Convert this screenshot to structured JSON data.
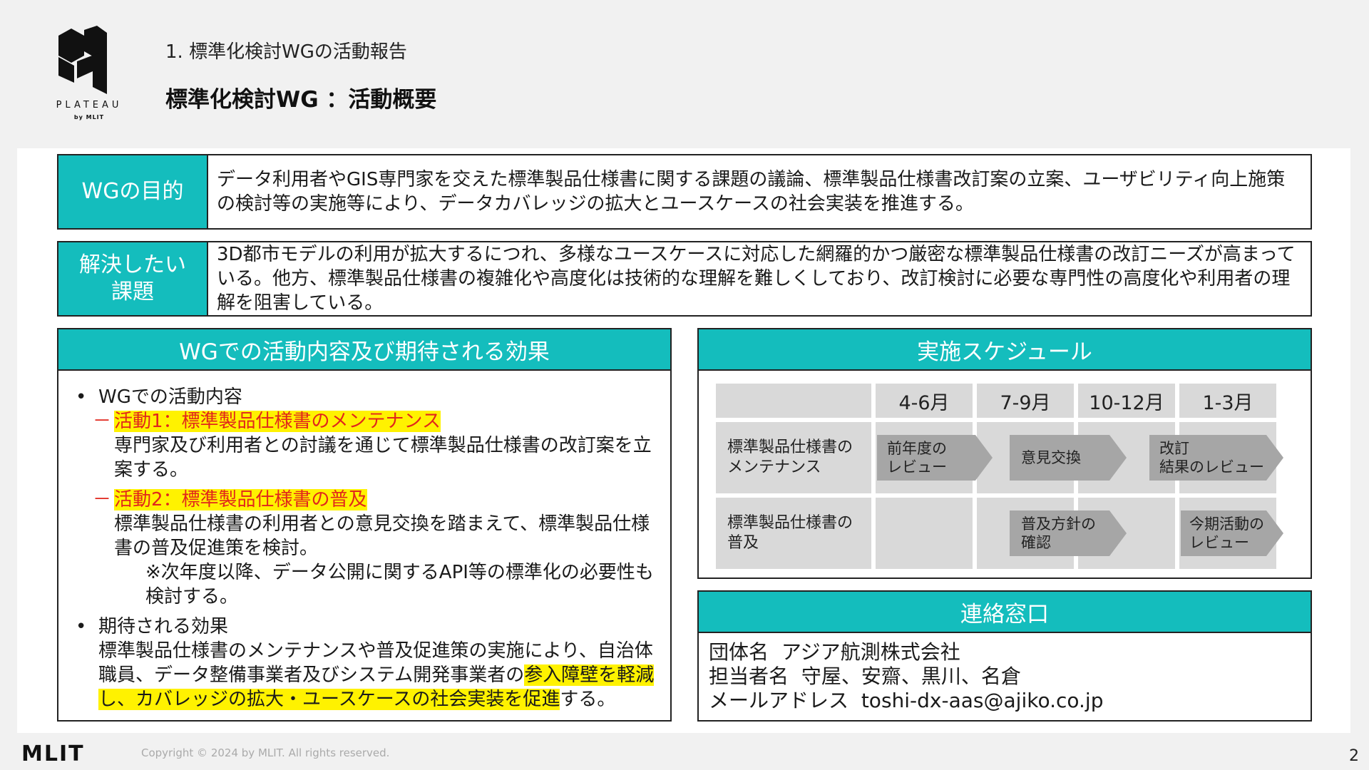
{
  "header": {
    "logo_text": "PLATEAU",
    "logo_sub": "by MLIT",
    "section_title": "1. 標準化検討WGの活動報告",
    "page_title": "標準化検討WG ：活動概要"
  },
  "purpose": {
    "label": "WGの目的",
    "text": "データ利用者やGIS専門家を交えた標準製品仕様書に関する課題の議論、標準製品仕様書改訂案の立案、ユーザビリティ向上施策の検討等の実施等により、データカバレッジの拡大とユースケースの社会実装を推進する。"
  },
  "issue": {
    "label_line1": "解決したい",
    "label_line2": "課題",
    "text": "3D都市モデルの利用が拡大するにつれ、多様なユースケースに対応した網羅的かつ厳密な標準製品仕様書の改訂ニーズが高まっている。他方、標準製品仕様書の複雑化や高度化は技術的な理解を難しくしており、改訂検討に必要な専門性の高度化や利用者の理解を阻害している。"
  },
  "activities": {
    "title": "WGでの活動内容及び期待される効果",
    "bullet1": "WGでの活動内容",
    "item1_title": "活動1：標準製品仕様書のメンテナンス",
    "item1_body": "専門家及び利用者との討議を通じて標準製品仕様書の改訂案を立案する。",
    "item2_title": "活動2：標準製品仕様書の普及",
    "item2_body": "標準製品仕様書の利用者との意見交換を踏まえて、標準製品仕様書の普及促進策を検討。",
    "item2_note": "※次年度以降、データ公開に関するAPI等の標準化の必要性も検討する。",
    "bullet2": "期待される効果",
    "effect_pre": "標準製品仕様書のメンテナンスや普及促進策の実施により、自治体職員、データ整備事業者及びシステム開発事業者の",
    "effect_highlight": "参入障壁を軽減し、カバレッジの拡大・ユースケースの社会実装を促進",
    "effect_post": "する。"
  },
  "schedule": {
    "title": "実施スケジュール",
    "periods": [
      "4-6月",
      "7-9月",
      "10-12月",
      "1-3月"
    ],
    "rows": [
      {
        "label": "標準製品仕様書の\nメンテナンス",
        "tasks": [
          "前年度の\nレビュー",
          "意見交換",
          "改訂\n結果のレビュー"
        ]
      },
      {
        "label": "標準製品仕様書の\n普及",
        "tasks": [
          "普及方針の\n確認",
          "今期活動の\nレビュー"
        ]
      }
    ]
  },
  "contact": {
    "title": "連絡窓口",
    "org_label": "団体名",
    "org_value": "アジア航測株式会社",
    "person_label": "担当者名",
    "person_value": "守屋、安齋、黒川、名倉",
    "email_label": "メールアドレス",
    "email_value": "toshi-dx-aas@ajiko.co.jp"
  },
  "footer": {
    "logo": "MLIT",
    "copyright": "Copyright © 2024 by MLIT. All rights reserved.",
    "page_number": "2"
  },
  "colors": {
    "accent": "#14bdbd",
    "highlight": "#fff200",
    "item_title": "#e1261c",
    "gantt_bg": "#d9d9d9",
    "chevron": "#a6a6a6"
  }
}
